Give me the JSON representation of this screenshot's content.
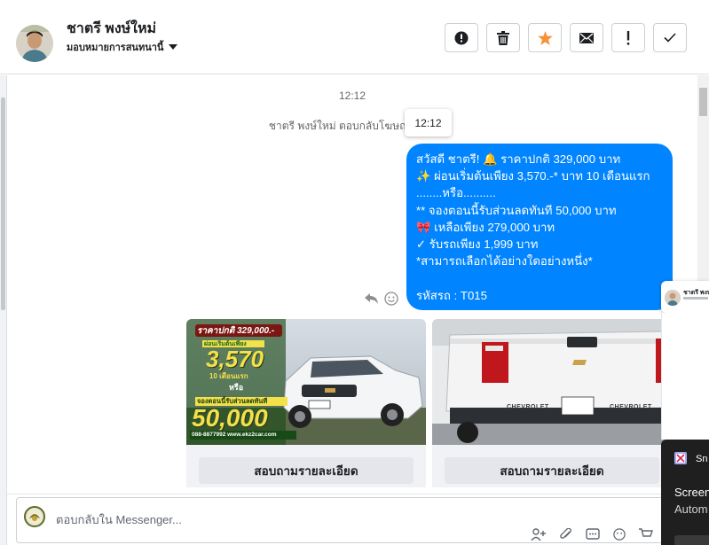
{
  "header": {
    "contact_name": "ชาตรี พงษ์ใหม่",
    "assign_label": "มอบหมายการสนทนานี้",
    "actions": [
      {
        "name": "report-icon",
        "label": "!"
      },
      {
        "name": "trash-icon"
      },
      {
        "name": "star-icon",
        "color": "#f7923a"
      },
      {
        "name": "mail-icon"
      },
      {
        "name": "exclamation-icon",
        "label": "!"
      },
      {
        "name": "check-icon"
      }
    ]
  },
  "thread": {
    "timestamp": "12:12",
    "reply_note": "ชาตรี พงษ์ใหม่ ตอบกลับโฆษณา",
    "tooltip": "12:12",
    "message_lines": [
      "สวัสดี ชาตรี! 🔔  ราคาปกติ 329,000 บาท",
      "✨  ผ่อนเริ่มต้นเพียง 3,570.-* บาท 10 เดือนแรก",
      "........หรือ..........",
      "** จองตอนนี้รับส่วนลดทันที 50,000 บาท",
      "🎀  เหลือเพียง 279,000 บาท",
      "✓ รับรถเพียง 1,999 บาท",
      "*สามารถเลือกได้อย่างใดอย่างหนึ่ง*",
      "",
      " รหัสรถ : T015"
    ],
    "bubble_color": "#0084ff",
    "cards": [
      {
        "button_label": "สอบถามรายละเอียด",
        "image": {
          "price_text": "ราคาปกติ 329,000.-",
          "installment_prefix": "ผ่อนเริ่มต้นเพียง",
          "installment_amount": "3,570",
          "installment_suffix": "10 เดือนแรก",
          "or_text": "หรือ",
          "discount_prefix": "จองตอนนี้รับส่วนลดทันที",
          "discount_amount": "50,000",
          "phone_site": "088-8877992 www.ekz2car.com"
        }
      },
      {
        "button_label": "สอบถามรายละเอียด",
        "image": {
          "tailgate_brand": "CHEVROLET"
        }
      }
    ]
  },
  "composer": {
    "placeholder": "ตอบกลับใน Messenger..."
  },
  "side_preview": {
    "name": "ชาตรี พงษ์ใหม่"
  },
  "toast": {
    "app": "Sn",
    "title": "Screen",
    "body": "Autom"
  }
}
